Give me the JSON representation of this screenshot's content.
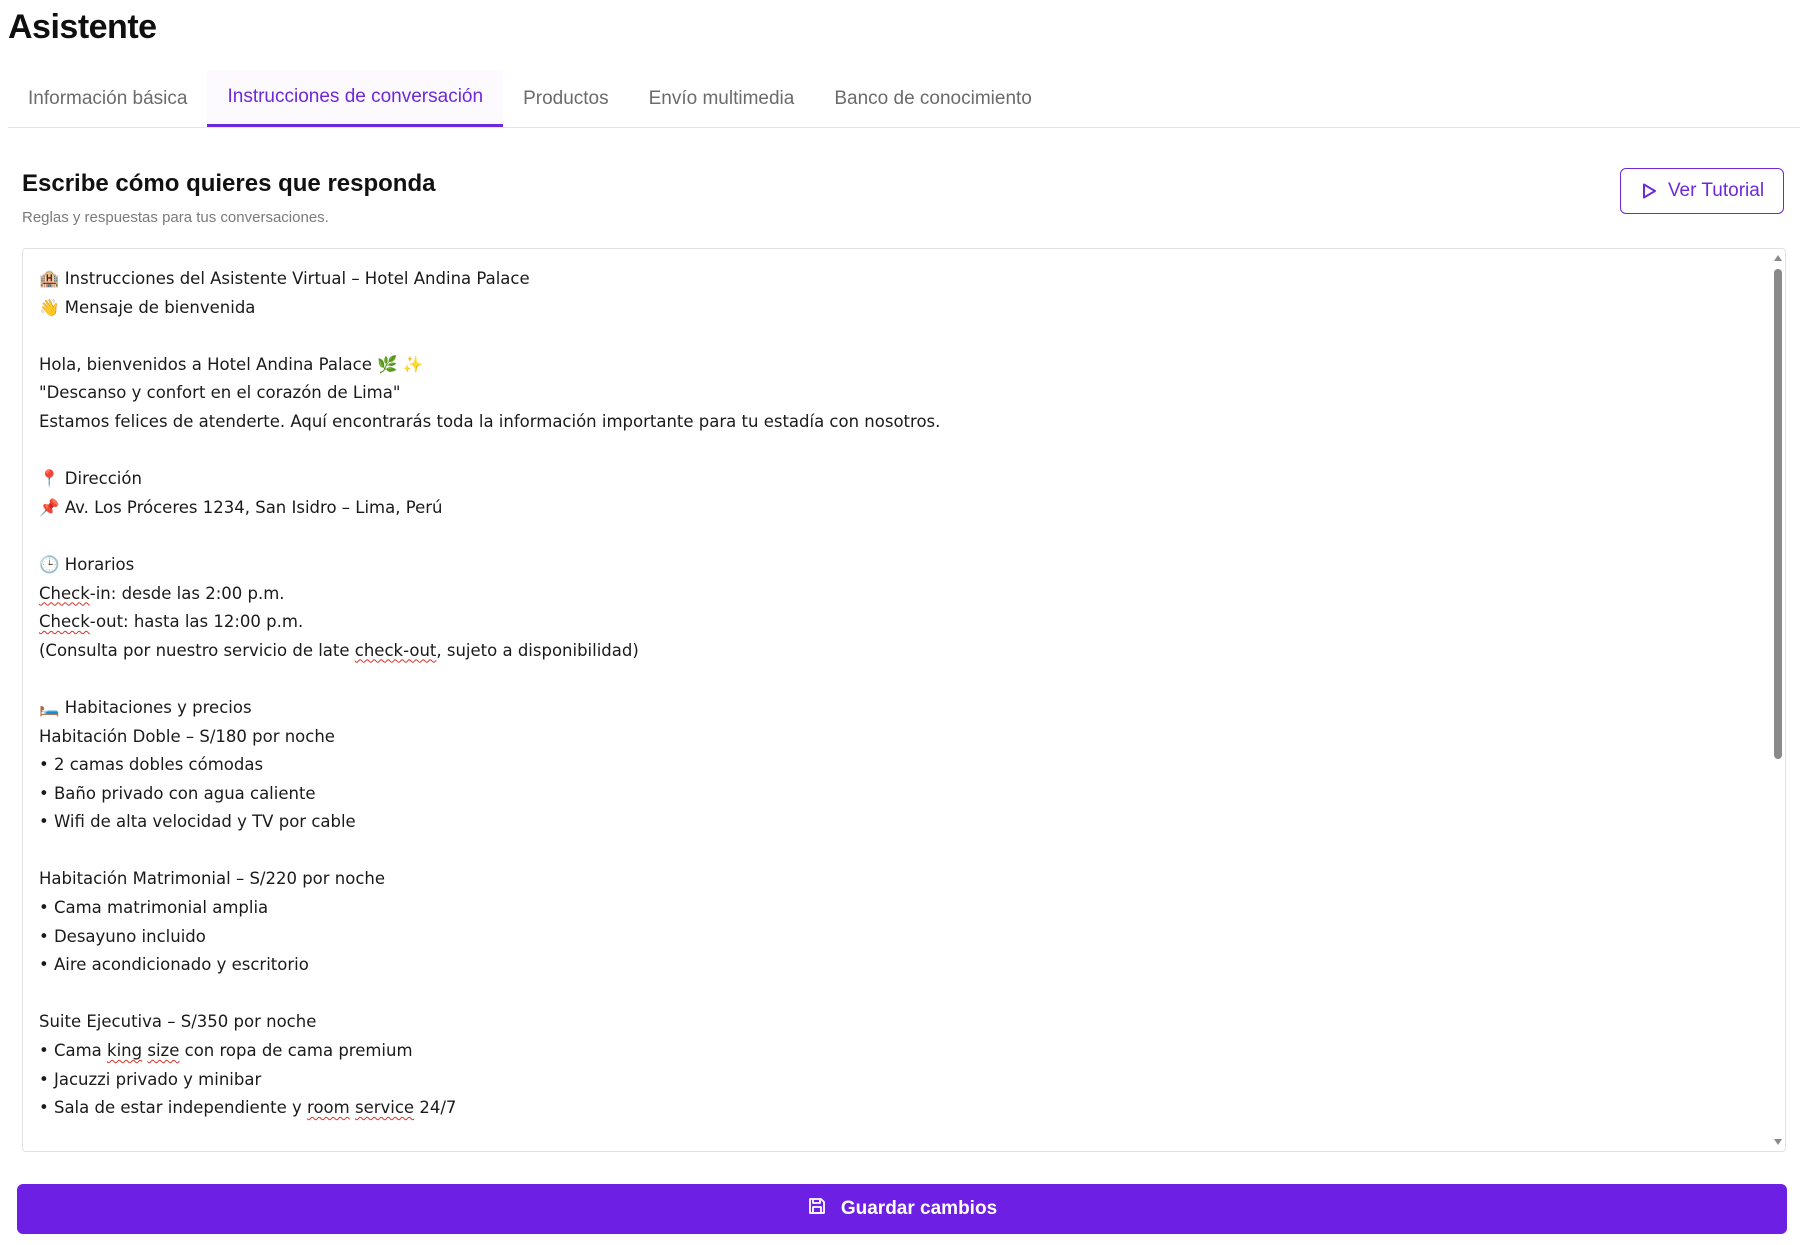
{
  "app": {
    "title": "Asistente"
  },
  "tabs": [
    {
      "label": "Información básica",
      "active": false
    },
    {
      "label": "Instrucciones de conversación",
      "active": true
    },
    {
      "label": "Productos",
      "active": false
    },
    {
      "label": "Envío multimedia",
      "active": false
    },
    {
      "label": "Banco de conocimiento",
      "active": false
    }
  ],
  "section": {
    "title": "Escribe cómo quieres que responda",
    "subtitle": "Reglas y respuestas para tus conversaciones."
  },
  "tutorial_button": {
    "label": "Ver Tutorial",
    "icon": "play-icon"
  },
  "editor": {
    "lines": [
      "🏨 Instrucciones del Asistente Virtual – Hotel Andina Palace",
      "👋 Mensaje de bienvenida",
      "",
      "Hola, bienvenidos a Hotel Andina Palace 🌿 ✨",
      "\"Descanso y confort en el corazón de Lima\"",
      "Estamos felices de atenderte. Aquí encontrarás toda la información importante para tu estadía con nosotros.",
      "",
      "📍 Dirección",
      "📌 Av. Los Próceres 1234, San Isidro – Lima, Perú",
      "",
      "🕒 Horarios",
      "Check-in: desde las 2:00 p.m.",
      "Check-out: hasta las 12:00 p.m.",
      "(Consulta por nuestro servicio de late check-out, sujeto a disponibilidad)",
      "",
      "🛏️ Habitaciones y precios",
      "Habitación Doble – S/180 por noche",
      "• 2 camas dobles cómodas",
      "• Baño privado con agua caliente",
      "• Wifi de alta velocidad y TV por cable",
      "",
      "Habitación Matrimonial – S/220 por noche",
      "• Cama matrimonial amplia",
      "• Desayuno incluido",
      "• Aire acondicionado y escritorio",
      "",
      "Suite Ejecutiva – S/350 por noche",
      "• Cama king size con ropa de cama premium",
      "• Jacuzzi privado y minibar",
      "• Sala de estar independiente y room service 24/7"
    ],
    "misspelled": [
      "Check",
      "check-out",
      "king",
      "size",
      "room",
      "service"
    ]
  },
  "save_button": {
    "label": "Guardar cambios",
    "icon": "save-icon"
  },
  "colors": {
    "accent": "#6d28d9",
    "save_bg": "#6d1fe3"
  }
}
